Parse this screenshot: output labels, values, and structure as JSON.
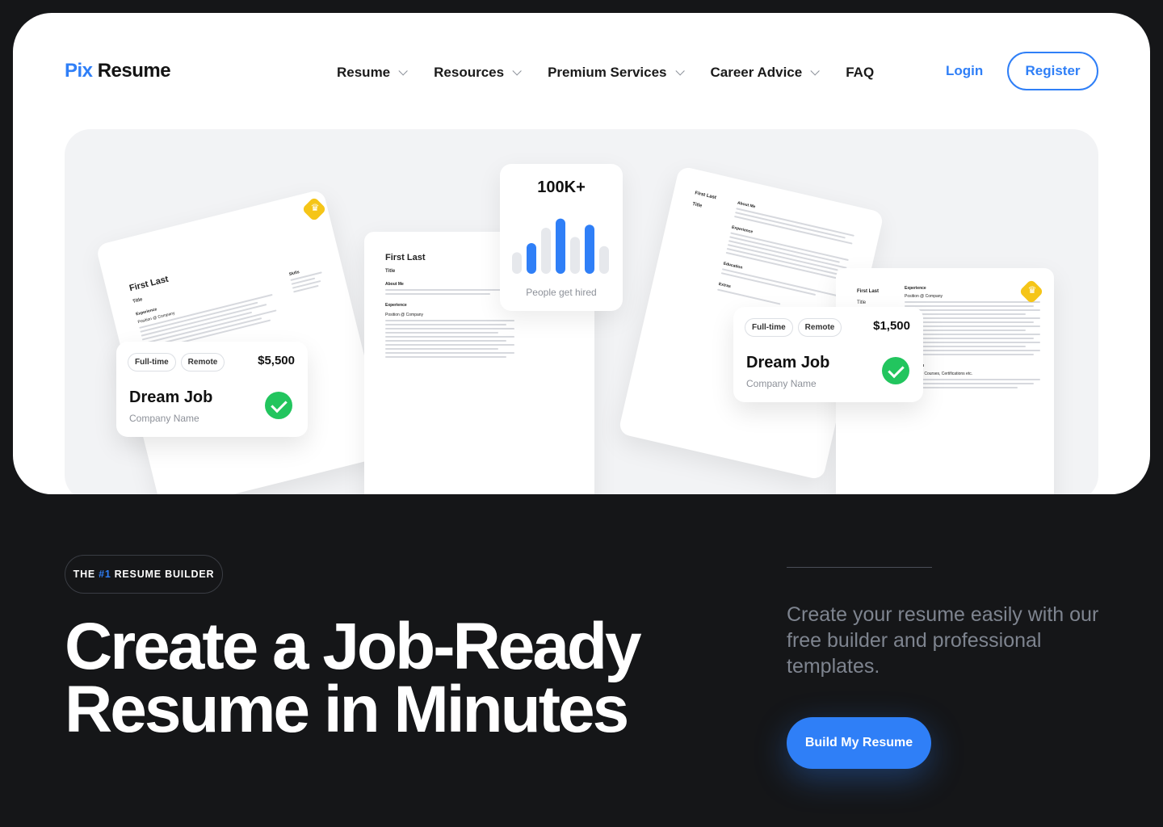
{
  "logo": {
    "part1": "Pix",
    "part2": "Resume"
  },
  "nav": {
    "items": [
      {
        "label": "Resume",
        "has_dropdown": true
      },
      {
        "label": "Resources",
        "has_dropdown": true
      },
      {
        "label": "Premium Services",
        "has_dropdown": true
      },
      {
        "label": "Career Advice",
        "has_dropdown": true
      },
      {
        "label": "FAQ",
        "has_dropdown": false
      }
    ],
    "login": "Login",
    "register": "Register"
  },
  "hero": {
    "resume_left": {
      "name": "First Last",
      "title": "Title",
      "section1": "Experience",
      "section2": "Skills",
      "position": "Position @ Company"
    },
    "resume_center": {
      "name": "First Last",
      "title": "Title",
      "about": "About Me",
      "experience": "Experience",
      "position": "Position @ Company"
    },
    "resume_right": {
      "name": "First Last",
      "title": "Title",
      "about": "About Me",
      "experience": "Experience",
      "education": "Education",
      "extras": "Extras"
    },
    "resume_far_right": {
      "name": "First Last",
      "title": "Title",
      "experience": "Experience",
      "position": "Position @ Company",
      "education": "Education",
      "edu_line": "University, Courses, Certifications etc."
    },
    "job_card_1": {
      "tag1": "Full-time",
      "tag2": "Remote",
      "salary": "$5,500",
      "title": "Dream Job",
      "company": "Company Name"
    },
    "job_card_2": {
      "tag1": "Full-time",
      "tag2": "Remote",
      "salary": "$1,500",
      "title": "Dream Job",
      "company": "Company Name"
    },
    "stat": {
      "value": "100K+",
      "caption": "People get hired",
      "bars": [
        0.35,
        0.5,
        0.75,
        0.9,
        0.6,
        0.8,
        0.45
      ],
      "highlight": [
        1,
        3,
        5
      ],
      "accent": "#2f7ff7",
      "muted": "#e6e8ec"
    }
  },
  "badge": {
    "pre": "THE",
    "hl": "#1",
    "post": "RESUME BUILDER"
  },
  "headline": {
    "line1": "Create a Job-Ready",
    "line2": "Resume in Minutes"
  },
  "subtext": "Create your resume easily with our free builder and professional templates.",
  "cta": "Build My Resume",
  "colors": {
    "accent": "#2f7ff7",
    "background": "#151618",
    "success": "#22c55e"
  }
}
